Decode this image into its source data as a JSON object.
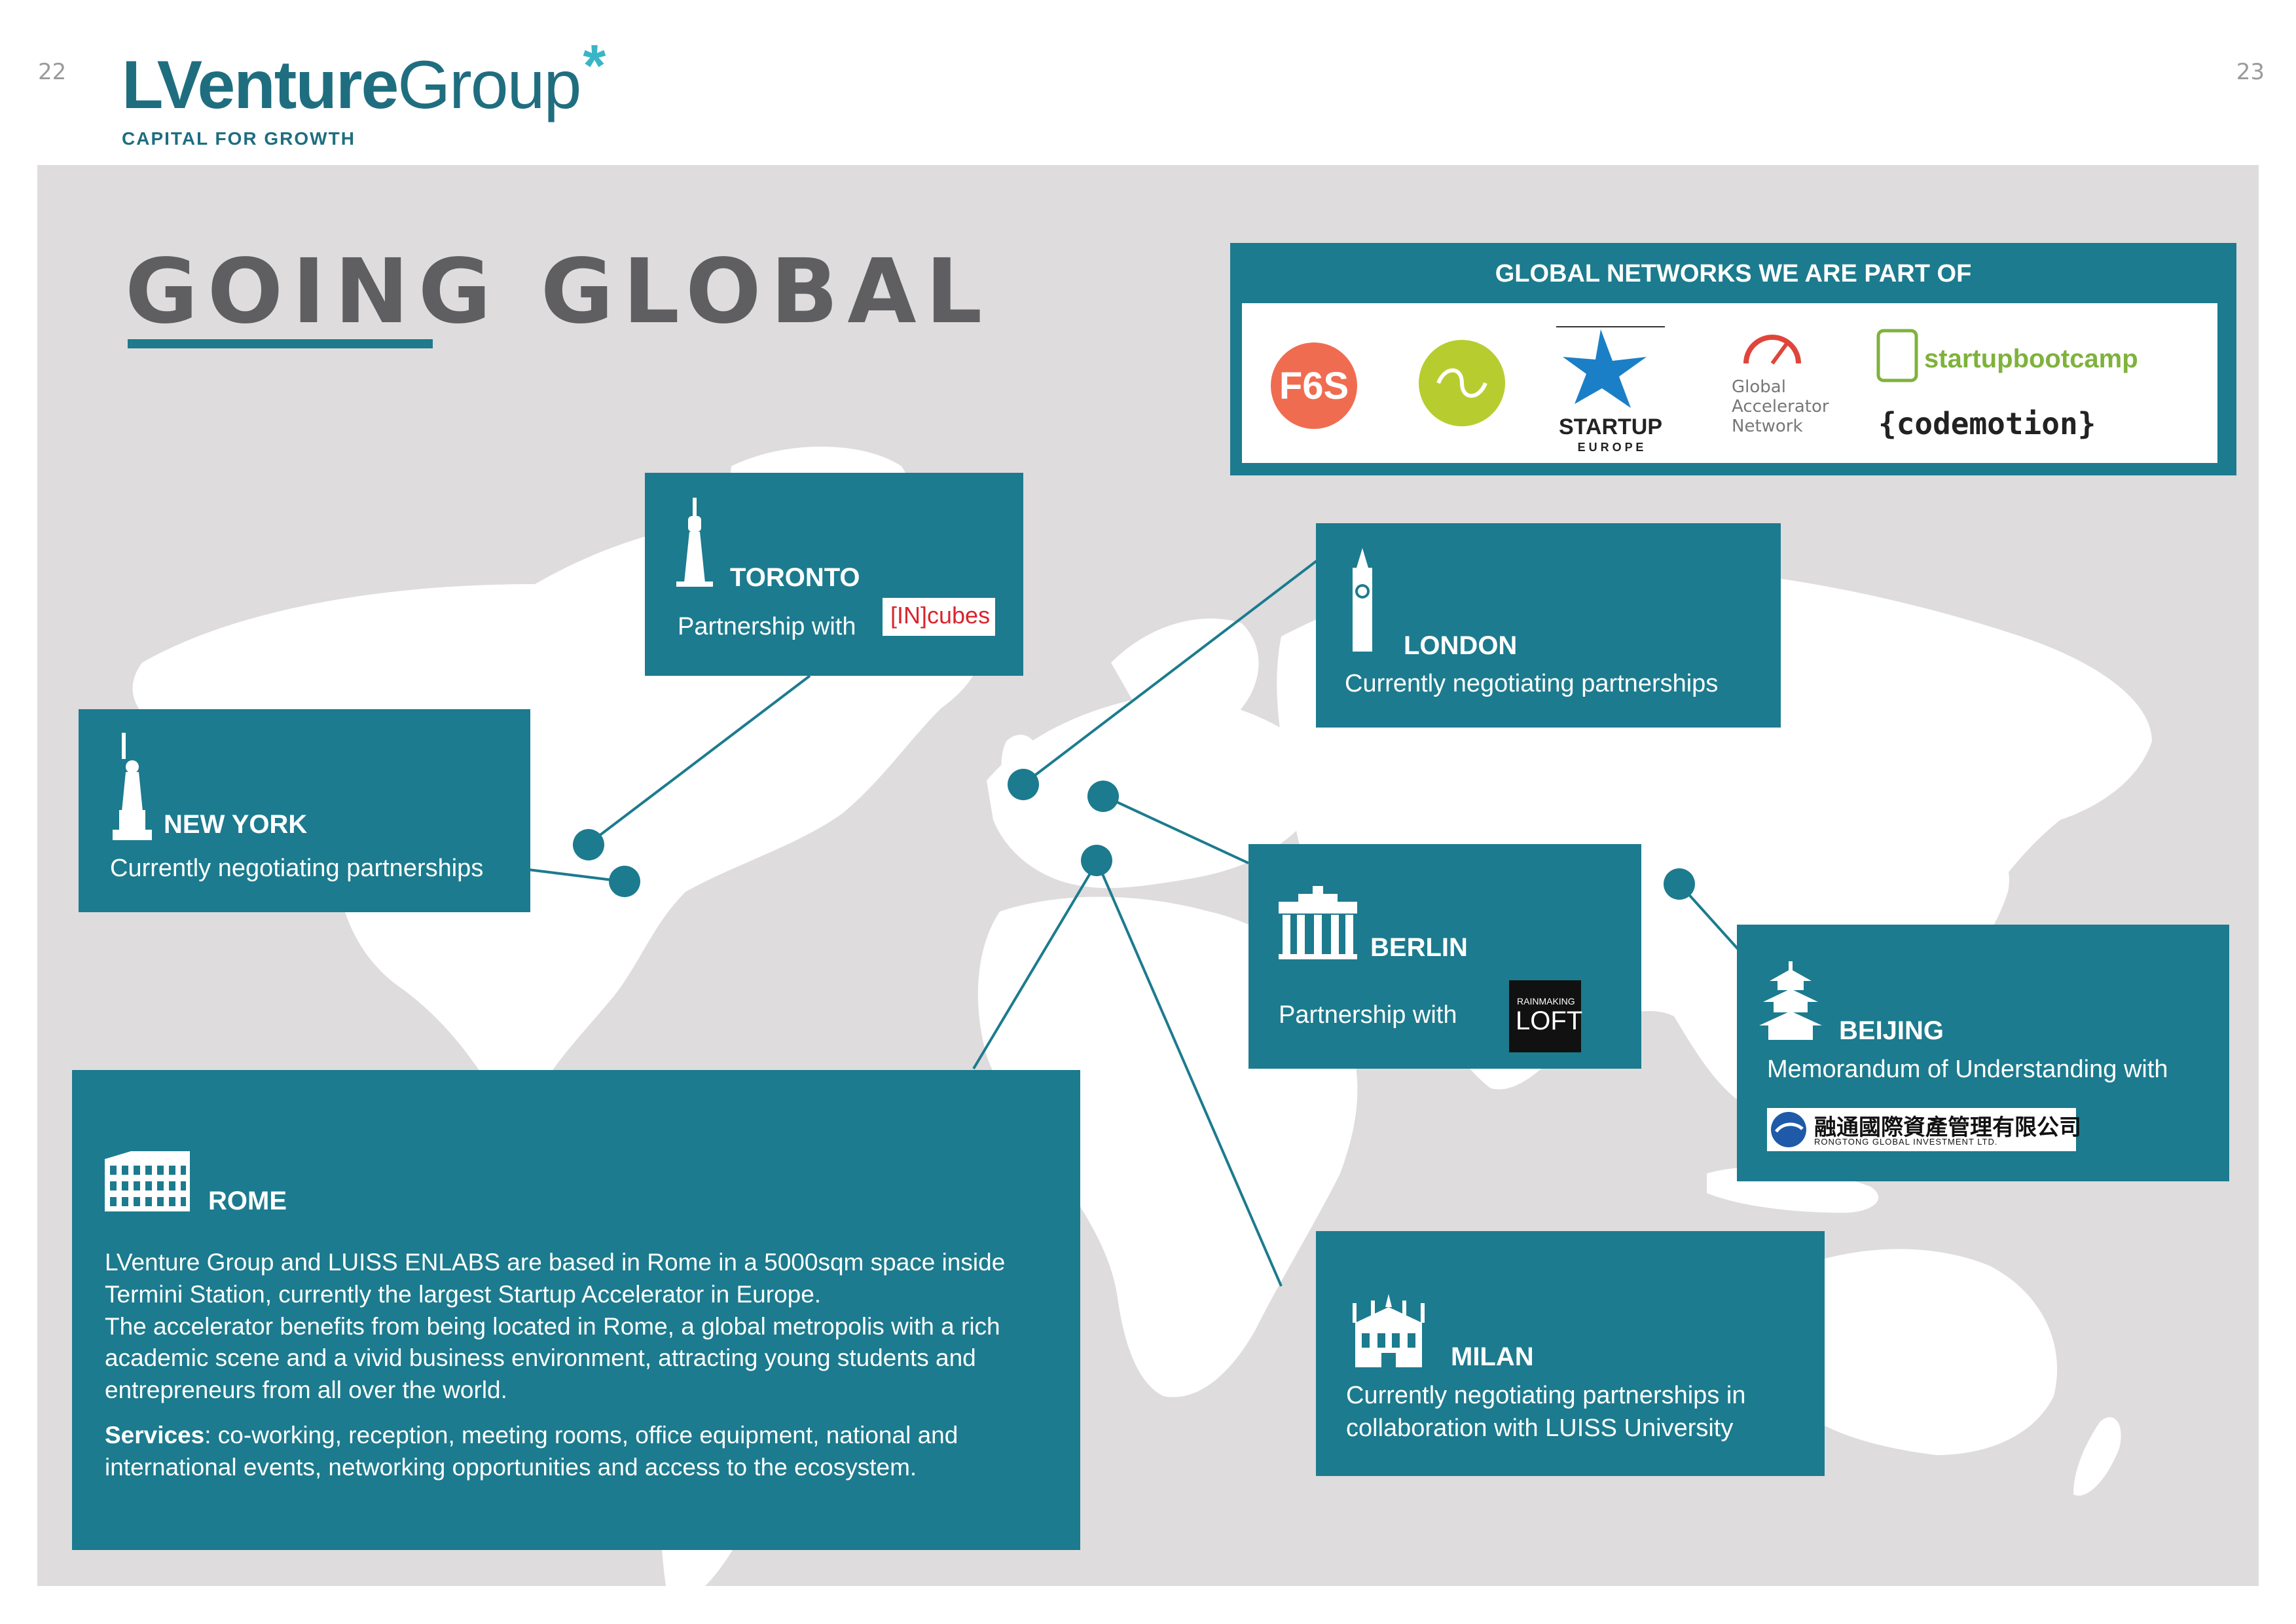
{
  "page_numbers": {
    "left": "22",
    "right": "23"
  },
  "brand": {
    "name_bold": "LVenture",
    "name_light": "Group",
    "star": "*",
    "tagline": "CAPITAL FOR GROWTH"
  },
  "title": "GOING GLOBAL",
  "networks": {
    "title": "GLOBAL NETWORKS WE ARE PART OF",
    "logos": {
      "f6s": "F6S",
      "startup_europe_line1": "STARTUP",
      "startup_europe_line2": "E U R O P E",
      "gan_line1": "Global",
      "gan_line2": "Accelerator",
      "gan_line3": "Network",
      "startupbootcamp": "startupbootcamp",
      "codemotion": "{codemotion}"
    }
  },
  "cities": {
    "toronto": {
      "name": "TORONTO",
      "text": "Partnership with",
      "partner_logo": "[IN]cubes"
    },
    "london": {
      "name": "LONDON",
      "text": "Currently negotiating partnerships"
    },
    "new_york": {
      "name": "NEW YORK",
      "text": "Currently negotiating partnerships"
    },
    "berlin": {
      "name": "BERLIN",
      "text": "Partnership with",
      "partner_logo_small": "RAINMAKING",
      "partner_logo": "LOFT"
    },
    "beijing": {
      "name": "BEIJING",
      "text": "Memorandum of Understanding with",
      "partner_logo_cn": "融通國際資產管理有限公司",
      "partner_logo_en": "RONGTONG GLOBAL INVESTMENT LTD."
    },
    "milan": {
      "name": "MILAN",
      "text": "Currently negotiating partnerships in collaboration with LUISS University"
    },
    "rome": {
      "name": "ROME",
      "paragraph1": "LVenture Group and LUISS ENLABS are based in Rome in a 5000sqm space inside Termini Station, currently the largest Startup Accelerator in Europe.",
      "paragraph2": "The accelerator benefits from being located in Rome, a global metropolis with a rich academic scene and a vivid business environment, attracting young students and entrepreneurs from all over the world.",
      "services_label": "Services",
      "services_text": ": co-working, reception, meeting rooms, office equipment, national and international events, networking opportunities and access to the ecosystem."
    }
  },
  "colors": {
    "teal": "#1c7b8e",
    "brand": "#1f6e80",
    "map_bg": "#dedcdd",
    "land": "#ffffff",
    "title": "#5f5f61"
  }
}
